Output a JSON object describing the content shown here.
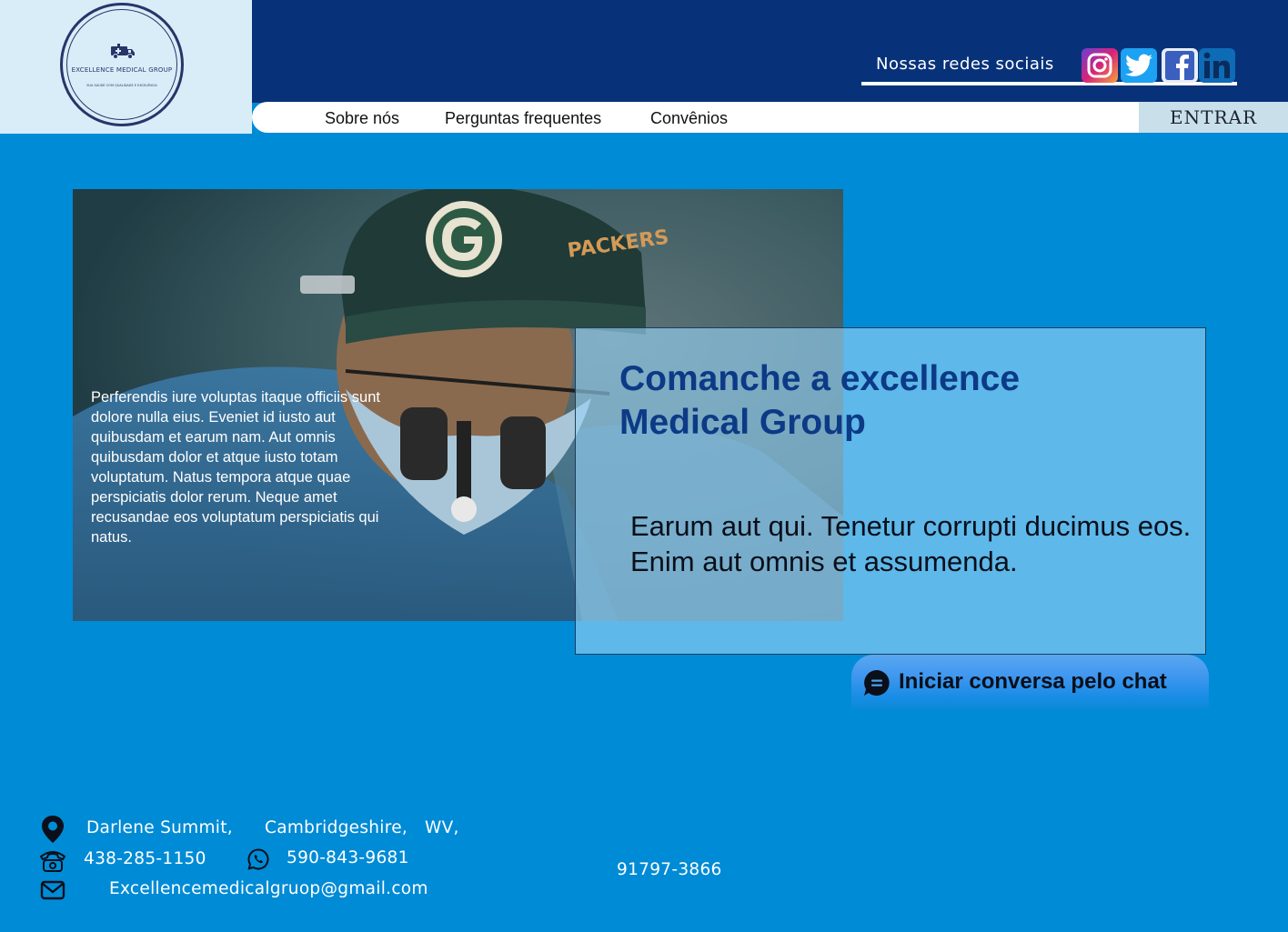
{
  "brand": {
    "name": "EXCELLENCE MEDICAL GROUP",
    "tagline": "SUA SAÚDE COM QUALIDADE E EXCELÊNCIA"
  },
  "header": {
    "social_label": "Nossas redes sociais",
    "social_icons": [
      "instagram-icon",
      "twitter-icon",
      "facebook-icon",
      "linkedin-icon"
    ],
    "nav": [
      "Sobre nós",
      "Perguntas frequentes",
      "Convênios"
    ],
    "login_label": "ENTRAR"
  },
  "hero": {
    "image_text": "Perferendis iure voluptas itaque officiis sunt dolore nulla eius. Eveniet id iusto aut quibusdam et earum nam. Aut omnis quibusdam dolor et atque iusto totam voluptatum. Natus tempora atque quae perspiciatis dolor rerum. Neque amet recusandae eos voluptatum perspiciatis qui natus.",
    "title": "Comanche a excellence Medical Group",
    "body": "Earum aut qui. Tenetur corrupti ducimus eos. Enim aut omnis et assumenda."
  },
  "chat": {
    "label": "Iniciar conversa pelo chat"
  },
  "footer": {
    "address": [
      "Darlene Summit,",
      "Cambridgeshire,",
      "WV,"
    ],
    "phone": "438-285-1150",
    "whatsapp": "590-843-9681",
    "email": "Excellencemedicalgruop@gmail.com",
    "postal_code": "91797-3866"
  },
  "colors": {
    "background": "#008bd6",
    "top_bar": "#07327a",
    "card_title": "#0c3a86"
  }
}
